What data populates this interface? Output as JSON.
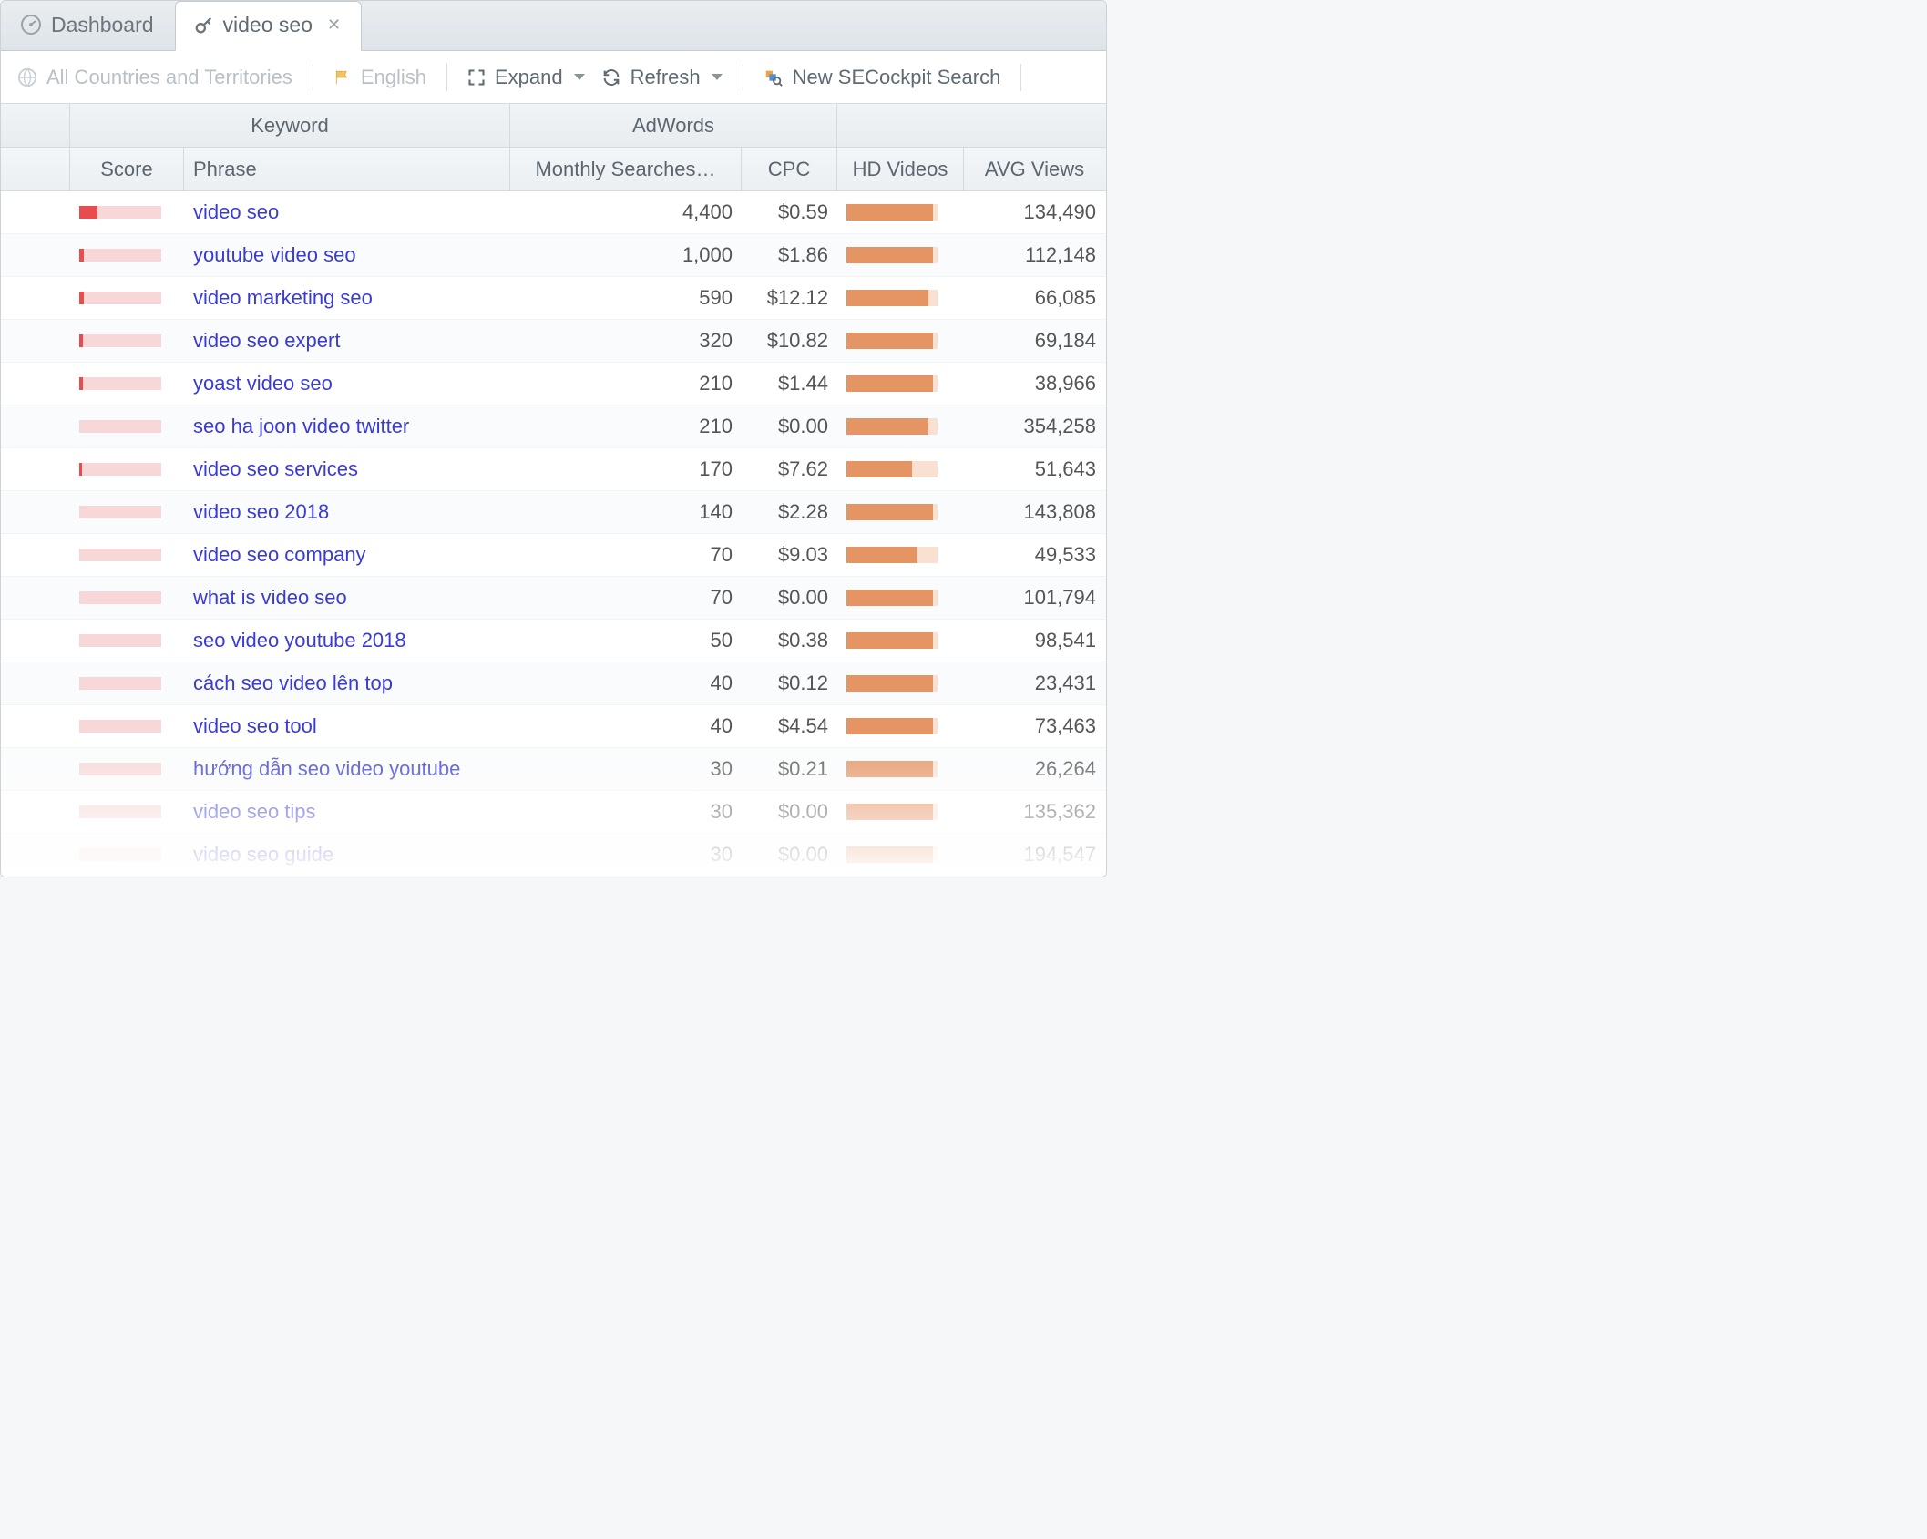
{
  "tabs": [
    {
      "label": "Dashboard",
      "icon": "gauge",
      "active": false
    },
    {
      "label": "video seo",
      "icon": "key",
      "active": true,
      "closable": true
    }
  ],
  "toolbar": {
    "region": "All Countries and Territories",
    "language": "English",
    "expand": "Expand",
    "refresh": "Refresh",
    "new_search": "New SECockpit Search"
  },
  "columns": {
    "group_keyword": "Keyword",
    "group_adwords": "AdWords",
    "score": "Score",
    "phrase": "Phrase",
    "searches": "Monthly Searches…",
    "cpc": "CPC",
    "hd": "HD Videos",
    "avg": "AVG Views"
  },
  "rows": [
    {
      "score_pct": 22,
      "phrase": "video seo",
      "searches": "4,400",
      "cpc": "$0.59",
      "hd_pct": 95,
      "avg": "134,490"
    },
    {
      "score_pct": 5,
      "phrase": "youtube video seo",
      "searches": "1,000",
      "cpc": "$1.86",
      "hd_pct": 95,
      "avg": "112,148"
    },
    {
      "score_pct": 6,
      "phrase": "video marketing seo",
      "searches": "590",
      "cpc": "$12.12",
      "hd_pct": 90,
      "avg": "66,085"
    },
    {
      "score_pct": 4,
      "phrase": "video seo expert",
      "searches": "320",
      "cpc": "$10.82",
      "hd_pct": 95,
      "avg": "69,184"
    },
    {
      "score_pct": 4,
      "phrase": "yoast video seo",
      "searches": "210",
      "cpc": "$1.44",
      "hd_pct": 95,
      "avg": "38,966"
    },
    {
      "score_pct": 0,
      "phrase": "seo ha joon video twitter",
      "searches": "210",
      "cpc": "$0.00",
      "hd_pct": 90,
      "avg": "354,258"
    },
    {
      "score_pct": 3,
      "phrase": "video seo services",
      "searches": "170",
      "cpc": "$7.62",
      "hd_pct": 72,
      "avg": "51,643"
    },
    {
      "score_pct": 0,
      "phrase": "video seo 2018",
      "searches": "140",
      "cpc": "$2.28",
      "hd_pct": 95,
      "avg": "143,808"
    },
    {
      "score_pct": 0,
      "phrase": "video seo company",
      "searches": "70",
      "cpc": "$9.03",
      "hd_pct": 78,
      "avg": "49,533"
    },
    {
      "score_pct": 0,
      "phrase": "what is video seo",
      "searches": "70",
      "cpc": "$0.00",
      "hd_pct": 95,
      "avg": "101,794"
    },
    {
      "score_pct": 0,
      "phrase": "seo video youtube 2018",
      "searches": "50",
      "cpc": "$0.38",
      "hd_pct": 95,
      "avg": "98,541"
    },
    {
      "score_pct": 0,
      "phrase": "cách seo video lên top",
      "searches": "40",
      "cpc": "$0.12",
      "hd_pct": 95,
      "avg": "23,431"
    },
    {
      "score_pct": 0,
      "phrase": "video seo tool",
      "searches": "40",
      "cpc": "$4.54",
      "hd_pct": 95,
      "avg": "73,463"
    },
    {
      "score_pct": 0,
      "phrase": "hướng dẫn seo video youtube",
      "searches": "30",
      "cpc": "$0.21",
      "hd_pct": 95,
      "avg": "26,264"
    },
    {
      "score_pct": 0,
      "phrase": "video seo tips",
      "searches": "30",
      "cpc": "$0.00",
      "hd_pct": 95,
      "avg": "135,362"
    },
    {
      "score_pct": 0,
      "phrase": "video seo guide",
      "searches": "30",
      "cpc": "$0.00",
      "hd_pct": 95,
      "avg": "194,547"
    }
  ]
}
